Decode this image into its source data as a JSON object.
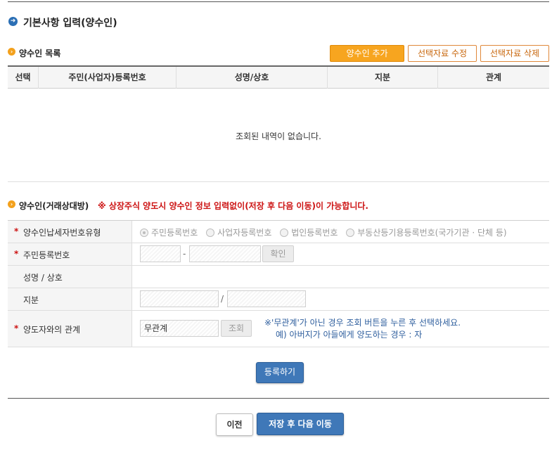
{
  "header": {
    "title": "기본사항 입력(양수인)"
  },
  "list": {
    "title": "양수인 목록",
    "buttons": {
      "add": "양수인 추가",
      "edit": "선택자료 수정",
      "delete": "선택자료 삭제"
    },
    "columns": [
      "선택",
      "주민(사업자)등록번호",
      "성명/상호",
      "지분",
      "관계"
    ],
    "empty_message": "조회된 내역이 없습니다."
  },
  "form": {
    "title": "양수인(거래상대방)",
    "notice": "※ 상장주식 양도시 양수인 정보 입력없이(저장 후 다음 이동)이 가능합니다.",
    "required_mark": "*",
    "taxpayer_type": {
      "label": "양수인납세자번호유형",
      "options": [
        "주민등록번호",
        "사업자등록번호",
        "법인등록번호",
        "부동산등기용등록번호(국가기관 · 단체 등)"
      ]
    },
    "resident_no": {
      "label": "주민등록번호",
      "separator": "-",
      "confirm": "확인"
    },
    "name": {
      "label": "성명 / 상호"
    },
    "share": {
      "label": "지분",
      "separator": "/"
    },
    "relation": {
      "label": "양도자와의 관계",
      "value": "무관계",
      "lookup": "조회",
      "hint_line1": "※'무관계'가 아닌 경우 조회 버튼을 누른 후 선택하세요.",
      "hint_line2": "예) 아버지가 아들에게 양도하는 경우 : 자"
    },
    "register": "등록하기"
  },
  "footer": {
    "prev": "이전",
    "save_next": "저장 후 다음 이동"
  },
  "colors": {
    "accent_blue": "#3f78b8",
    "accent_orange": "#f7a51f",
    "notice_red": "#cc1111"
  }
}
